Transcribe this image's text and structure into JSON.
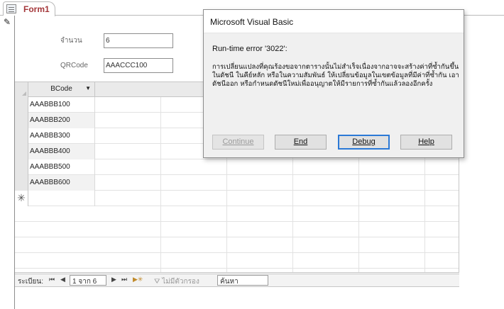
{
  "tab": {
    "title": "Form1",
    "icon": "form-icon"
  },
  "form": {
    "fields": [
      {
        "label": "จำนวน",
        "value": "6"
      },
      {
        "label": "QRCode",
        "value": "AAACCC100"
      }
    ],
    "pencil_icon": "pencil-edit-icon"
  },
  "datasheet": {
    "column_header": "BCode",
    "rows": [
      "AAABBB100",
      "AAABBB200",
      "AAABBB300",
      "AAABBB400",
      "AAABBB500",
      "AAABBB600"
    ],
    "new_row_marker": "✳"
  },
  "navigation": {
    "record_label": "ระเบียน:",
    "first": "⏮",
    "prev": "◀",
    "record_value": "1 จาก 6",
    "next": "▶",
    "last": "⏭",
    "new": "▶✳",
    "filter_label": "ไม่มีตัวกรอง",
    "search_value": "ค้นหา"
  },
  "dialog": {
    "title": "Microsoft Visual Basic",
    "error_title": "Run-time error '3022':",
    "error_message": "การเปลี่ยนแปลงที่คุณร้องขอจากตารางนั้นไม่สำเร็จเนื่องจากอาจจะสร้างค่าที่ซ้ำกันขึ้นในดัชนี ในคีย์หลัก หรือในความสัมพันธ์ ให้เปลี่ยนข้อมูลในเขตข้อมูลที่มีค่าที่ซ้ำกัน เอาดัชนีออก หรือกำหนดดัชนีใหม่เพื่ออนุญาตให้มีรายการที่ซ้ำกันแล้วลองอีกครั้ง",
    "buttons": {
      "continue": "Continue",
      "end": "End",
      "debug": "Debug",
      "help": "Help"
    }
  }
}
